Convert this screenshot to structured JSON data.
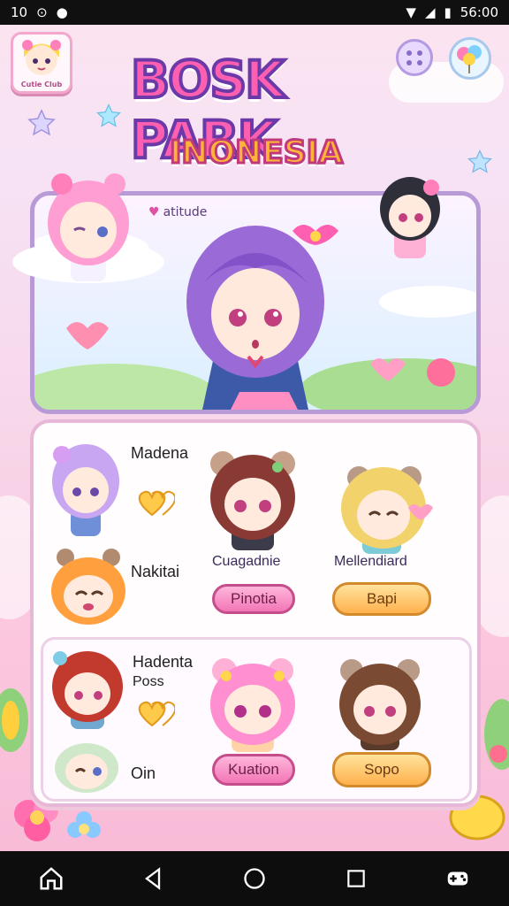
{
  "status_bar": {
    "left_text": "10",
    "time": "56:00"
  },
  "header": {
    "profile_label": "Cutie Club",
    "logo_line1": "BOSK PARK",
    "logo_line2": "INONESIA"
  },
  "banner": {
    "tag": "atitude"
  },
  "panel": {
    "row1": {
      "left_name": "Madena",
      "left_secondary": "Nakitai",
      "mid_name": "Cuagadnie",
      "right_name": "Mellendiard",
      "mid_button": "Pinotia",
      "right_button": "Bapi"
    },
    "row2": {
      "left_name": "Hadenta",
      "left_sub": "Poss",
      "left_secondary": "Oin",
      "mid_button": "Kuation",
      "right_button": "Sopo"
    }
  },
  "colors": {
    "accent_pink": "#f276b6",
    "accent_orange": "#ffb14d",
    "frame_purple": "#b79ad6"
  }
}
